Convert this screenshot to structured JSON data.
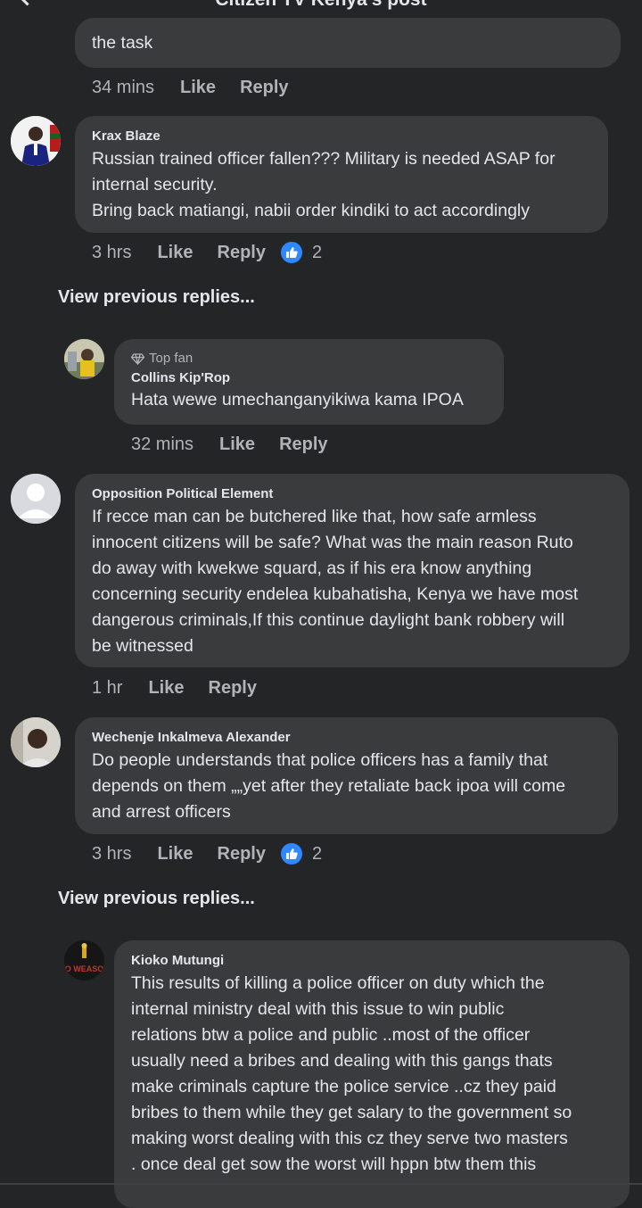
{
  "header": {
    "title": "Citizen TV Kenya's post"
  },
  "c0": {
    "text": "the task",
    "time": "34 mins",
    "like": "Like",
    "reply": "Reply"
  },
  "c1": {
    "author": "Krax Blaze",
    "text": "Russian trained officer fallen???  Military is needed ASAP for internal security.\nBring back matiangi, nabii order kindiki to act accordingly",
    "time": "3 hrs",
    "like": "Like",
    "reply": "Reply",
    "reactions": "2"
  },
  "view_prev_1": "View previous replies...",
  "c2": {
    "badge": "Top fan",
    "author": "Collins Kip'Rop",
    "text": "Hata wewe umechanganyikiwa kama IPOA",
    "time": "32 mins",
    "like": "Like",
    "reply": "Reply"
  },
  "c3": {
    "author": "Opposition Political Element",
    "text": "If recce man can be butchered like that, how safe armless\ninnocent citizens will be safe? What was the main reason Ruto\ndo away with kwekwe squard, as if his era know anything\nconcerning security endelea kubahatisha, Kenya we have most\ndangerous criminals,If this continue daylight bank robbery will\nbe witnessed",
    "time": "1 hr",
    "like": "Like",
    "reply": "Reply"
  },
  "c4": {
    "author": "Wechenje Inkalmeva Alexander",
    "text": "Do people understands that police officers has a family that\ndepends on them „„yet after they retaliate back ipoa will come\nand arrest officers",
    "time": "3 hrs",
    "like": "Like",
    "reply": "Reply",
    "reactions": "2"
  },
  "view_prev_2": "View previous replies...",
  "c5": {
    "author": "Kioko Mutungi",
    "avatar_text": "O WEASO",
    "text": "This results of killing a police officer on duty   which the\ninternal ministry deal with this issue  to win public\nrelations btw a police and public ..most of the officer\nusually need a bribes and dealing with this gangs  thats\nmake criminals capture  the police service ..cz they paid\nbribes to them while they get salary to the government so\nmaking worst dealing with this cz they serve two masters\n. once deal get sow the worst will hppn  btw them    this"
  }
}
